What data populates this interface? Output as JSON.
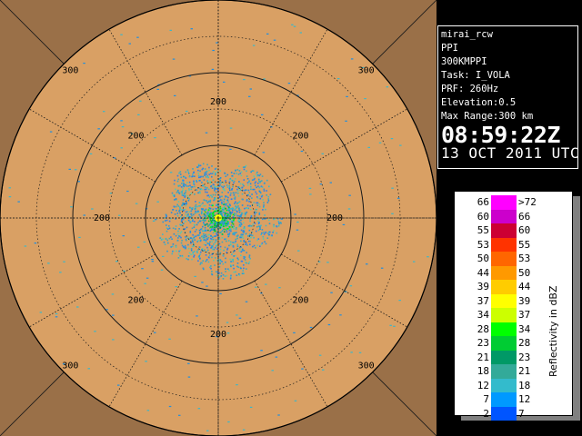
{
  "radar": {
    "range_rings_km": [
      50,
      100,
      150,
      200,
      250,
      300
    ],
    "ring_labels": [
      {
        "text": "300",
        "angle_deg": 315
      },
      {
        "text": "300",
        "angle_deg": 45
      },
      {
        "text": "300",
        "angle_deg": 135
      },
      {
        "text": "300",
        "angle_deg": 225
      },
      {
        "text": "200",
        "angle_deg": 0
      },
      {
        "text": "200",
        "angle_deg": 90
      },
      {
        "text": "200",
        "angle_deg": 180
      },
      {
        "text": "200",
        "angle_deg": 270
      },
      {
        "text": "200",
        "angle_deg": 315
      },
      {
        "text": "200",
        "angle_deg": 45
      },
      {
        "text": "200",
        "angle_deg": 135
      },
      {
        "text": "200",
        "angle_deg": 225
      }
    ],
    "colors": {
      "background": "#9a7048",
      "disk": "#d9a064",
      "grid": "#1a1a1a"
    }
  },
  "info": {
    "station": "mirai_rcw",
    "product": "PPI",
    "product_name": "300KMPPI",
    "task": "Task: I_VOLA",
    "prf": "PRF: 260Hz",
    "elevation": "Elevation:0.5",
    "max_range": "Max Range:300 km",
    "time": "08:59:22Z",
    "date": "13 OCT 2011 UTC"
  },
  "legend": {
    "units_label": "Reflectivity in dBZ",
    "rows": [
      {
        "low": "66",
        "high": ">72",
        "color": "#ff00ff"
      },
      {
        "low": "60",
        "high": "66",
        "color": "#cc00cc"
      },
      {
        "low": "55",
        "high": "60",
        "color": "#cc0033"
      },
      {
        "low": "53",
        "high": "55",
        "color": "#ff3300"
      },
      {
        "low": "50",
        "high": "53",
        "color": "#ff6600"
      },
      {
        "low": "44",
        "high": "50",
        "color": "#ff9900"
      },
      {
        "low": "39",
        "high": "44",
        "color": "#ffcc00"
      },
      {
        "low": "37",
        "high": "39",
        "color": "#ffff00"
      },
      {
        "low": "34",
        "high": "37",
        "color": "#ccff00"
      },
      {
        "low": "28",
        "high": "34",
        "color": "#00ff00"
      },
      {
        "low": "23",
        "high": "28",
        "color": "#00cc33"
      },
      {
        "low": "21",
        "high": "23",
        "color": "#009966"
      },
      {
        "low": "18",
        "high": "21",
        "color": "#33aa99"
      },
      {
        "low": "12",
        "high": "18",
        "color": "#33bbcc"
      },
      {
        "low": "7",
        "high": "12",
        "color": "#0099ff"
      },
      {
        "low": "2",
        "high": "7",
        "color": "#0055ff"
      }
    ]
  }
}
